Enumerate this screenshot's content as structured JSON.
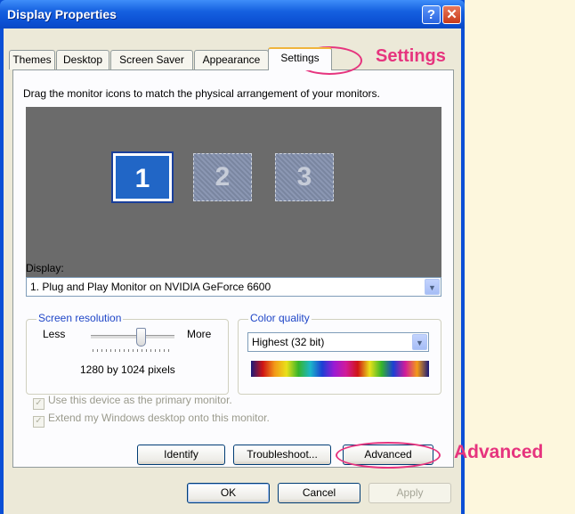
{
  "window": {
    "title": "Display Properties",
    "help_label": "?",
    "close_label": "✕"
  },
  "tabs": [
    {
      "label": "Themes"
    },
    {
      "label": "Desktop"
    },
    {
      "label": "Screen Saver"
    },
    {
      "label": "Appearance"
    },
    {
      "label": "Settings",
      "active": true
    }
  ],
  "settings": {
    "instruction": "Drag the monitor icons to match the physical arrangement of your monitors.",
    "monitors": [
      "1",
      "2",
      "3"
    ],
    "display_label": "Display:",
    "display_value": "1. Plug and Play Monitor on NVIDIA GeForce 6600",
    "resolution": {
      "legend": "Screen resolution",
      "less": "Less",
      "more": "More",
      "value_text": "1280 by 1024 pixels"
    },
    "color_quality": {
      "legend": "Color quality",
      "value": "Highest (32 bit)"
    },
    "checkboxes": [
      {
        "label": "Use this device as the primary monitor.",
        "checked": true,
        "disabled": true
      },
      {
        "label": "Extend my Windows desktop onto this monitor.",
        "checked": true,
        "disabled": true
      }
    ],
    "buttons": {
      "identify": "Identify",
      "troubleshoot": "Troubleshoot...",
      "advanced": "Advanced"
    }
  },
  "footer": {
    "ok": "OK",
    "cancel": "Cancel",
    "apply": "Apply"
  },
  "annotations": {
    "settings_callout": "Settings",
    "advanced_callout": "Advanced",
    "color": "#e6347e"
  }
}
